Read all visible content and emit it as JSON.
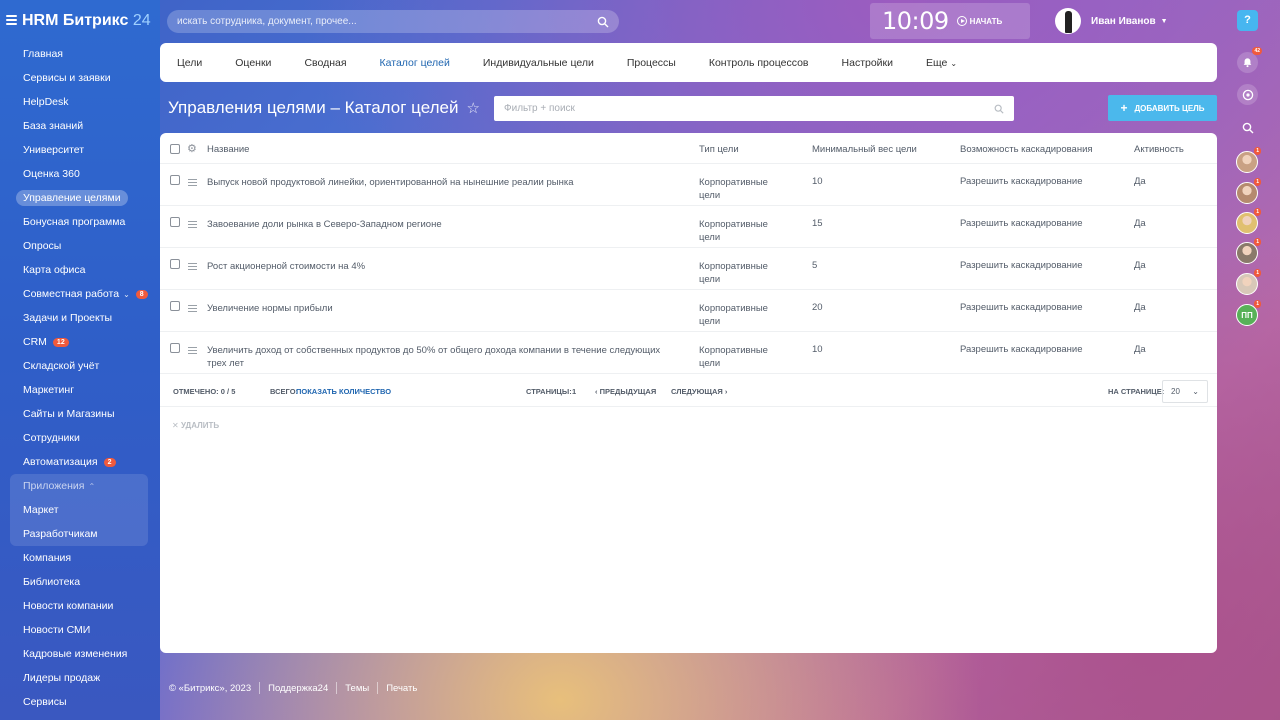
{
  "app": {
    "logo_text": "HRM Битрикс",
    "logo_num": "24",
    "search_placeholder": "искать сотрудника, документ, прочее...",
    "clock_time": "10:09",
    "clock_start": "НАЧАТЬ",
    "user_name": "Иван Иванов",
    "help": "?"
  },
  "sidebar": {
    "items": [
      {
        "label": "Главная"
      },
      {
        "label": "Сервисы и заявки"
      },
      {
        "label": "HelpDesk"
      },
      {
        "label": "База знаний"
      },
      {
        "label": "Университет"
      },
      {
        "label": "Оценка 360"
      },
      {
        "label": "Управление целями",
        "active": true
      },
      {
        "label": "Бонусная программа"
      },
      {
        "label": "Опросы"
      },
      {
        "label": "Карта офиса"
      },
      {
        "label": "Совместная работа",
        "badge": "8"
      },
      {
        "label": "Задачи и Проекты"
      },
      {
        "label": "CRM",
        "badge": "12"
      },
      {
        "label": "Складской учёт"
      },
      {
        "label": "Маркетинг"
      },
      {
        "label": "Сайты и Магазины"
      },
      {
        "label": "Сотрудники"
      },
      {
        "label": "Автоматизация",
        "badge": "2"
      }
    ],
    "group_title": "Приложения",
    "group_items": [
      {
        "label": "Маркет"
      },
      {
        "label": "Разработчикам"
      }
    ],
    "items_after": [
      {
        "label": "Компания"
      },
      {
        "label": "Библиотека"
      },
      {
        "label": "Новости компании"
      },
      {
        "label": "Новости СМИ"
      },
      {
        "label": "Кадровые изменения"
      },
      {
        "label": "Лидеры продаж"
      },
      {
        "label": "Сервисы"
      }
    ]
  },
  "tabs": [
    {
      "label": "Цели"
    },
    {
      "label": "Оценки"
    },
    {
      "label": "Сводная"
    },
    {
      "label": "Каталог целей",
      "active": true
    },
    {
      "label": "Индивидуальные цели"
    },
    {
      "label": "Процессы"
    },
    {
      "label": "Контроль процессов"
    },
    {
      "label": "Настройки"
    },
    {
      "label": "Еще"
    }
  ],
  "page": {
    "title": "Управления целями – Каталог целей",
    "filter_placeholder": "Фильтр + поиск",
    "add_button": "ДОБАВИТЬ ЦЕЛЬ"
  },
  "table": {
    "headers": {
      "name": "Название",
      "type": "Тип цели",
      "weight": "Минимальный вес цели",
      "cascade": "Возможность каскадирования",
      "active": "Активность"
    },
    "rows": [
      {
        "name": "Выпуск новой продуктовой линейки, ориентированной на нынешние реалии рынка",
        "type": "Корпоративные цели",
        "weight": "10",
        "cascade": "Разрешить каскадирование",
        "active": "Да"
      },
      {
        "name": "Завоевание доли рынка в Северо-Западном регионе",
        "type": "Корпоративные цели",
        "weight": "15",
        "cascade": "Разрешить каскадирование",
        "active": "Да"
      },
      {
        "name": "Рост акционерной стоимости на 4%",
        "type": "Корпоративные цели",
        "weight": "5",
        "cascade": "Разрешить каскадирование",
        "active": "Да"
      },
      {
        "name": "Увеличение нормы прибыли",
        "type": "Корпоративные цели",
        "weight": "20",
        "cascade": "Разрешить каскадирование",
        "active": "Да"
      },
      {
        "name": "Увеличить доход от собственных продуктов до 50% от общего дохода компании в течение следующих трех лет",
        "type": "Корпоративные цели",
        "weight": "10",
        "cascade": "Разрешить каскадирование",
        "active": "Да"
      }
    ],
    "footer": {
      "selected": "ОТМЕЧЕНО: 0 / 5",
      "total_label": "ВСЕГО:",
      "total_link": "ПОКАЗАТЬ КОЛИЧЕСТВО",
      "pages_label": "СТРАНИЦЫ:",
      "page_num": "1",
      "prev": "ПРЕДЫДУЩАЯ",
      "next": "СЛЕДУЮЩАЯ",
      "per_page_label": "НА СТРАНИЦЕ:",
      "per_page_value": "20"
    },
    "delete_label": "УДАЛИТЬ"
  },
  "footer": {
    "copyright": "© «Битрикс», 2023",
    "support": "Поддержка24",
    "themes": "Темы",
    "print": "Печать"
  },
  "rightbar": {
    "notifications_badge": "42",
    "avatar_badges": [
      "1",
      "1",
      "1",
      "1",
      "1",
      "1"
    ],
    "pp_initials": "ПП"
  },
  "colors": {
    "accent": "#2066b0",
    "add_button": "#4bb8ec",
    "badge": "#f05a3c",
    "sidebar": "#2f6ad0"
  }
}
